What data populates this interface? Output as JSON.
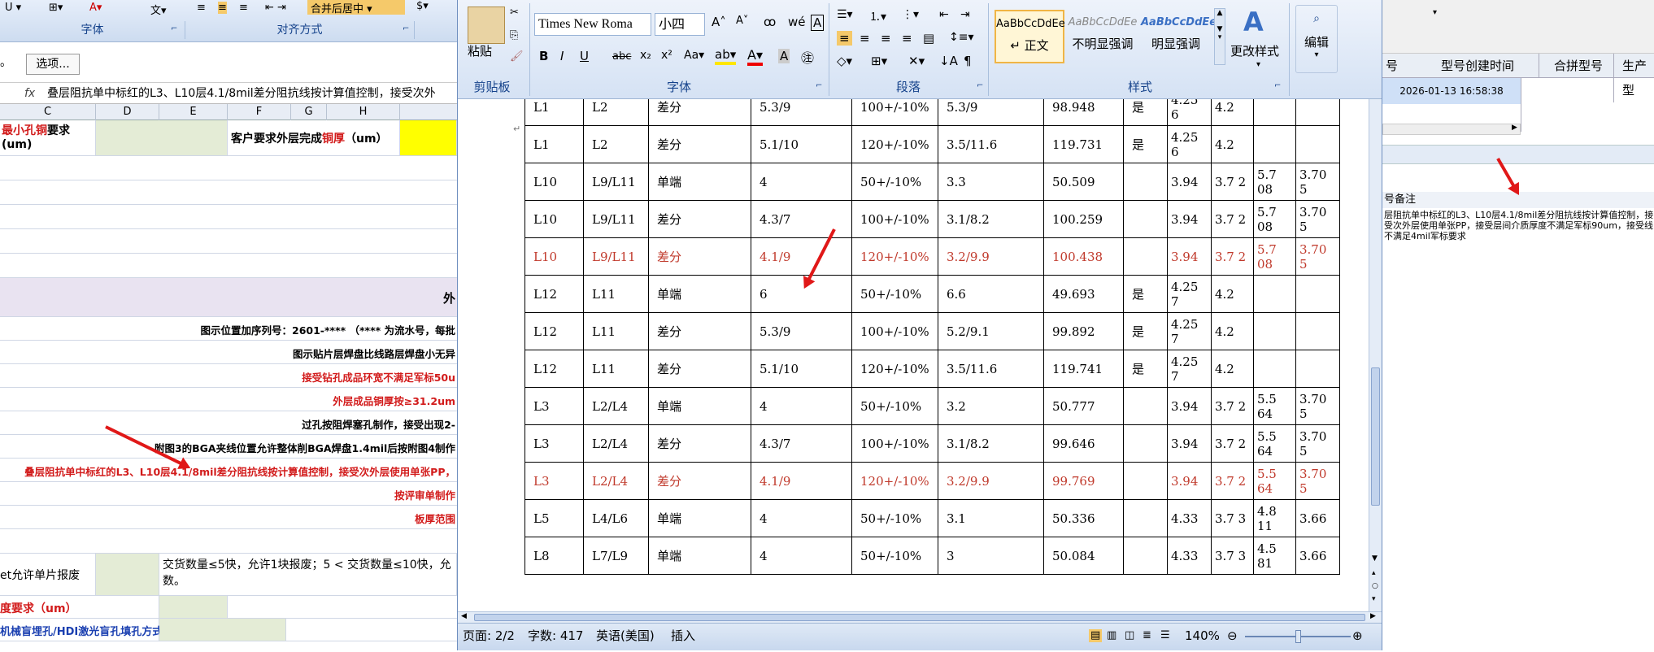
{
  "excel": {
    "ribbon_groups": {
      "font": "字体",
      "align": "对齐方式",
      "merge_center": "合并后居中"
    },
    "options_button": "选项...",
    "fx": "fx",
    "formula_text": "叠层阻抗单中标红的L3、L10层4.1/8mil差分阻抗线按计算值控制，接受次外",
    "col_headers": [
      "C",
      "D",
      "E",
      "F",
      "G",
      "H"
    ],
    "row1": {
      "c_label_red": "最小孔铜",
      "c_label_rest": "要求",
      "c_sub": "(um)",
      "f_label_pre": "客户要求外层完成",
      "f_label_red": "铜厚",
      "f_label_post": "（um）"
    },
    "section_label": "外",
    "rows": [
      {
        "text": "图示位置加序列号：2601-****  （**** 为流水号，每批",
        "color": "#000000"
      },
      {
        "text": "图示贴片层焊盘比线路层焊盘小无异",
        "color": "#000000"
      },
      {
        "text": "接受钻孔成品环宽不满足军标50u",
        "color": "#d21b1b"
      },
      {
        "text": "外层成品铜厚按≥31.2um",
        "color": "#d21b1b"
      },
      {
        "text": "过孔按阻焊塞孔制作，接受出现2-",
        "color": "#000000"
      },
      {
        "text": "附图3的BGA夹线位置允许整体削BGA焊盘1.4mil后按附图4制作",
        "color": "#000000"
      },
      {
        "text": "叠层阻抗单中标红的L3、L10层4.1/8mil差分阻抗线按计算值控制，接受次外层使用单张PP，",
        "color": "#d21b1b"
      },
      {
        "text": "按评审单制作",
        "color": "#d21b1b"
      },
      {
        "text": "板厚范围",
        "color": "#d21b1b"
      }
    ],
    "bottom_rows": {
      "allow_label": "et允许单片报废",
      "allow_note": "交货数量≤5快，允许1块报废；5 < 交货数量≤10快，允",
      "allow_note2": "数。",
      "thick_label": "度要求（um）",
      "hole_label": "机械盲埋孔/HDI激光盲孔填孔方式"
    }
  },
  "word": {
    "clipboard": {
      "paste": "粘贴",
      "group": "剪贴板"
    },
    "font": {
      "name": "Times New Roma",
      "size": "小四",
      "group": "字体"
    },
    "paragraph": {
      "group": "段落"
    },
    "styles": {
      "samples": [
        {
          "sample": "AaBbCcDdEe",
          "name": "↵ 正文"
        },
        {
          "sample": "AaBbCcDdEe",
          "name": "不明显强调"
        },
        {
          "sample": "AaBbCcDdEe",
          "name": "明显强调"
        }
      ],
      "change_styles": "更改样式",
      "group": "样式"
    },
    "editing": {
      "label": "编辑"
    },
    "table_rows": [
      {
        "c1": "L1",
        "c2": "L2",
        "c3": "差分",
        "c4": "5.3/9",
        "c5": "100+/-10%",
        "c6": "5.3/9",
        "c7": "98.948",
        "c8": "是",
        "c9": "4.25 6",
        "c10": "4.2",
        "c11": "",
        "c12": "",
        "red": false
      },
      {
        "c1": "L1",
        "c2": "L2",
        "c3": "差分",
        "c4": "5.1/10",
        "c5": "120+/-10%",
        "c6": "3.5/11.6",
        "c7": "119.731",
        "c8": "是",
        "c9": "4.25 6",
        "c10": "4.2",
        "c11": "",
        "c12": "",
        "red": false
      },
      {
        "c1": "L10",
        "c2": "L9/L11",
        "c3": "单端",
        "c4": "4",
        "c5": "50+/-10%",
        "c6": "3.3",
        "c7": "50.509",
        "c8": "",
        "c9": "3.94",
        "c10": "3.7 2",
        "c11": "5.7 08",
        "c12": "3.70 5",
        "red": false
      },
      {
        "c1": "L10",
        "c2": "L9/L11",
        "c3": "差分",
        "c4": "4.3/7",
        "c5": "100+/-10%",
        "c6": "3.1/8.2",
        "c7": "100.259",
        "c8": "",
        "c9": "3.94",
        "c10": "3.7 2",
        "c11": "5.7 08",
        "c12": "3.70 5",
        "red": false
      },
      {
        "c1": "L10",
        "c2": "L9/L11",
        "c3": "差分",
        "c4": "4.1/9",
        "c5": "120+/-10%",
        "c6": "3.2/9.9",
        "c7": "100.438",
        "c8": "",
        "c9": "3.94",
        "c10": "3.7 2",
        "c11": "5.7 08",
        "c12": "3.70 5",
        "red": true
      },
      {
        "c1": "L12",
        "c2": "L11",
        "c3": "单端",
        "c4": "6",
        "c5": "50+/-10%",
        "c6": "6.6",
        "c7": "49.693",
        "c8": "是",
        "c9": "4.25 7",
        "c10": "4.2",
        "c11": "",
        "c12": "",
        "red": false
      },
      {
        "c1": "L12",
        "c2": "L11",
        "c3": "差分",
        "c4": "5.3/9",
        "c5": "100+/-10%",
        "c6": "5.2/9.1",
        "c7": "99.892",
        "c8": "是",
        "c9": "4.25 7",
        "c10": "4.2",
        "c11": "",
        "c12": "",
        "red": false
      },
      {
        "c1": "L12",
        "c2": "L11",
        "c3": "差分",
        "c4": "5.1/10",
        "c5": "120+/-10%",
        "c6": "3.5/11.6",
        "c7": "119.741",
        "c8": "是",
        "c9": "4.25 7",
        "c10": "4.2",
        "c11": "",
        "c12": "",
        "red": false
      },
      {
        "c1": "L3",
        "c2": "L2/L4",
        "c3": "单端",
        "c4": "4",
        "c5": "50+/-10%",
        "c6": "3.2",
        "c7": "50.777",
        "c8": "",
        "c9": "3.94",
        "c10": "3.7 2",
        "c11": "5.5 64",
        "c12": "3.70 5",
        "red": false
      },
      {
        "c1": "L3",
        "c2": "L2/L4",
        "c3": "差分",
        "c4": "4.3/7",
        "c5": "100+/-10%",
        "c6": "3.1/8.2",
        "c7": "99.646",
        "c8": "",
        "c9": "3.94",
        "c10": "3.7 2",
        "c11": "5.5 64",
        "c12": "3.70 5",
        "red": false
      },
      {
        "c1": "L3",
        "c2": "L2/L4",
        "c3": "差分",
        "c4": "4.1/9",
        "c5": "120+/-10%",
        "c6": "3.2/9.9",
        "c7": "99.769",
        "c8": "",
        "c9": "3.94",
        "c10": "3.7 2",
        "c11": "5.5 64",
        "c12": "3.70 5",
        "red": true
      },
      {
        "c1": "L5",
        "c2": "L4/L6",
        "c3": "单端",
        "c4": "4",
        "c5": "50+/-10%",
        "c6": "3.1",
        "c7": "50.336",
        "c8": "",
        "c9": "4.33",
        "c10": "3.7 3",
        "c11": "4.8 11",
        "c12": "3.66",
        "red": false
      },
      {
        "c1": "L8",
        "c2": "L7/L9",
        "c3": "单端",
        "c4": "4",
        "c5": "50+/-10%",
        "c6": "3",
        "c7": "50.084",
        "c8": "",
        "c9": "4.33",
        "c10": "3.7 3",
        "c11": "4.5 81",
        "c12": "3.66",
        "red": false
      }
    ],
    "status": {
      "page": "页面: 2/2",
      "words": "字数: 417",
      "lang": "英语(美国)",
      "insert": "插入",
      "zoom": "140%"
    }
  },
  "right_panel": {
    "headers": [
      "号",
      "型号创建时间",
      "合拼型号",
      "生产型"
    ],
    "created": "2026-01-13 16:58:38",
    "note_label": "号备注",
    "note": "层阻抗单中标红的L3、L10层4.1/8mil差分阻抗线按计算值控制，接受次外层使用单张PP，接受层间介质厚度不满足军标90um，接受线不满足4mil军标要求"
  }
}
